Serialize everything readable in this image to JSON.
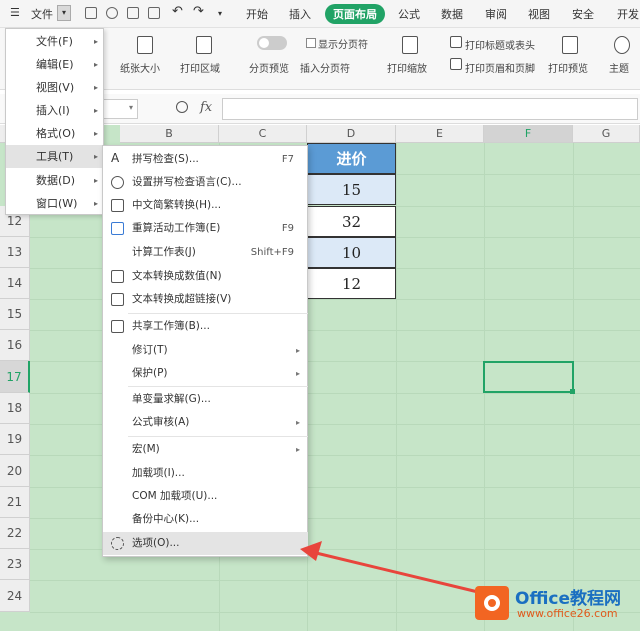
{
  "menubar": {
    "file_label": "文件",
    "tabs": [
      "开始",
      "插入",
      "页面布局",
      "公式",
      "数据",
      "审阅",
      "视图",
      "安全",
      "开发"
    ],
    "active_tab": "页面布局"
  },
  "ribbon": {
    "paper_size": "纸张大小",
    "print_area": "打印区域",
    "page_break_preview": "分页预览",
    "show_page_break": "显示分页符",
    "insert_page_break": "插入分页符",
    "print_scale": "打印缩放",
    "print_titles": "打印标题或表头",
    "print_header_footer": "打印页眉和页脚",
    "print_preview": "打印预览",
    "theme": "主题"
  },
  "formula_bar": {
    "fx": "fx"
  },
  "columns": [
    "B",
    "C",
    "D",
    "E",
    "F",
    "G"
  ],
  "selected_column": "F",
  "rows": [
    "12",
    "13",
    "14",
    "15",
    "16",
    "17",
    "18",
    "19",
    "20",
    "21",
    "22",
    "23",
    "24"
  ],
  "selected_row": "17",
  "table": {
    "header": "进价",
    "values": [
      "15",
      "32",
      "10",
      "12"
    ]
  },
  "file_menu": {
    "items": [
      {
        "label": "文件(F)",
        "submenu": true
      },
      {
        "label": "编辑(E)",
        "submenu": true
      },
      {
        "label": "视图(V)",
        "submenu": true
      },
      {
        "label": "插入(I)",
        "submenu": true
      },
      {
        "label": "格式(O)",
        "submenu": true
      },
      {
        "label": "工具(T)",
        "submenu": true
      },
      {
        "label": "数据(D)",
        "submenu": true
      },
      {
        "label": "窗口(W)",
        "submenu": true
      }
    ],
    "highlighted": "工具(T)"
  },
  "tools_menu": {
    "items": [
      {
        "label": "拼写检查(S)...",
        "shortcut": "F7",
        "icon": "spell-check-icon"
      },
      {
        "label": "设置拼写检查语言(C)...",
        "shortcut": "",
        "icon": "language-icon"
      },
      {
        "label": "中文简繁转换(H)...",
        "shortcut": "",
        "icon": "convert-icon"
      },
      {
        "label": "重算活动工作簿(E)",
        "shortcut": "F9",
        "icon": "recalc-icon"
      },
      {
        "label": "计算工作表(J)",
        "shortcut": "Shift+F9",
        "icon": ""
      },
      {
        "label": "文本转换成数值(N)",
        "shortcut": "",
        "icon": "text-to-number-icon"
      },
      {
        "label": "文本转换成超链接(V)",
        "shortcut": "",
        "icon": "text-to-link-icon"
      },
      {
        "label": "共享工作簿(B)...",
        "shortcut": "",
        "icon": "share-icon"
      },
      {
        "label": "修订(T)",
        "shortcut": "",
        "icon": "",
        "submenu": true
      },
      {
        "label": "保护(P)",
        "shortcut": "",
        "icon": "",
        "submenu": true
      },
      {
        "label": "单变量求解(G)...",
        "shortcut": "",
        "icon": ""
      },
      {
        "label": "公式审核(A)",
        "shortcut": "",
        "icon": "",
        "submenu": true
      },
      {
        "label": "宏(M)",
        "shortcut": "",
        "icon": "",
        "submenu": true
      },
      {
        "label": "加载项(I)...",
        "shortcut": "",
        "icon": ""
      },
      {
        "label": "COM 加载项(U)...",
        "shortcut": "",
        "icon": ""
      },
      {
        "label": "备份中心(K)...",
        "shortcut": "",
        "icon": ""
      },
      {
        "label": "选项(O)...",
        "shortcut": "",
        "icon": "gear-icon"
      }
    ],
    "highlighted": "选项(O)..."
  },
  "watermark": {
    "title": "Office教程网",
    "url": "www.office26.com"
  },
  "colors": {
    "accent": "#21a366",
    "grid": "#c6e5c8",
    "table_head": "#5b9bd5",
    "table_cell": "#dce9f7",
    "arrow": "#e8453c"
  }
}
